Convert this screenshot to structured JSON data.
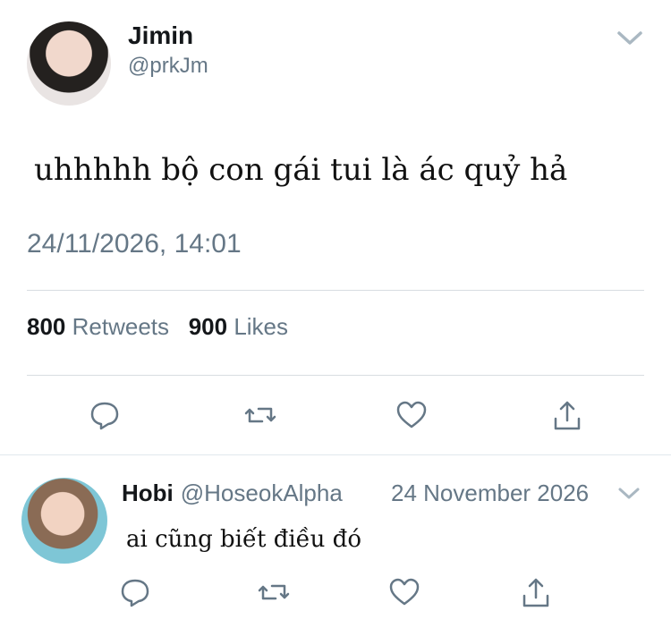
{
  "tweet": {
    "author_name": "Jimin",
    "author_handle": "@prkJm",
    "text": "uhhhhh bộ con gái tui là ác quỷ hả",
    "timestamp": "24/11/2026, 14:01",
    "retweets_count": "800",
    "retweets_label": "Retweets",
    "likes_count": "900",
    "likes_label": "Likes"
  },
  "reply": {
    "author_name": "Hobi",
    "author_handle": "@HoseokAlpha",
    "date": "24 November 2026",
    "text": "ai cũng biết điều đó"
  },
  "colors": {
    "text": "#14171a",
    "muted": "#657786",
    "divider": "#d8dde1"
  },
  "icons": [
    "chevron-down-icon",
    "reply-icon",
    "retweet-icon",
    "heart-icon",
    "share-icon"
  ]
}
